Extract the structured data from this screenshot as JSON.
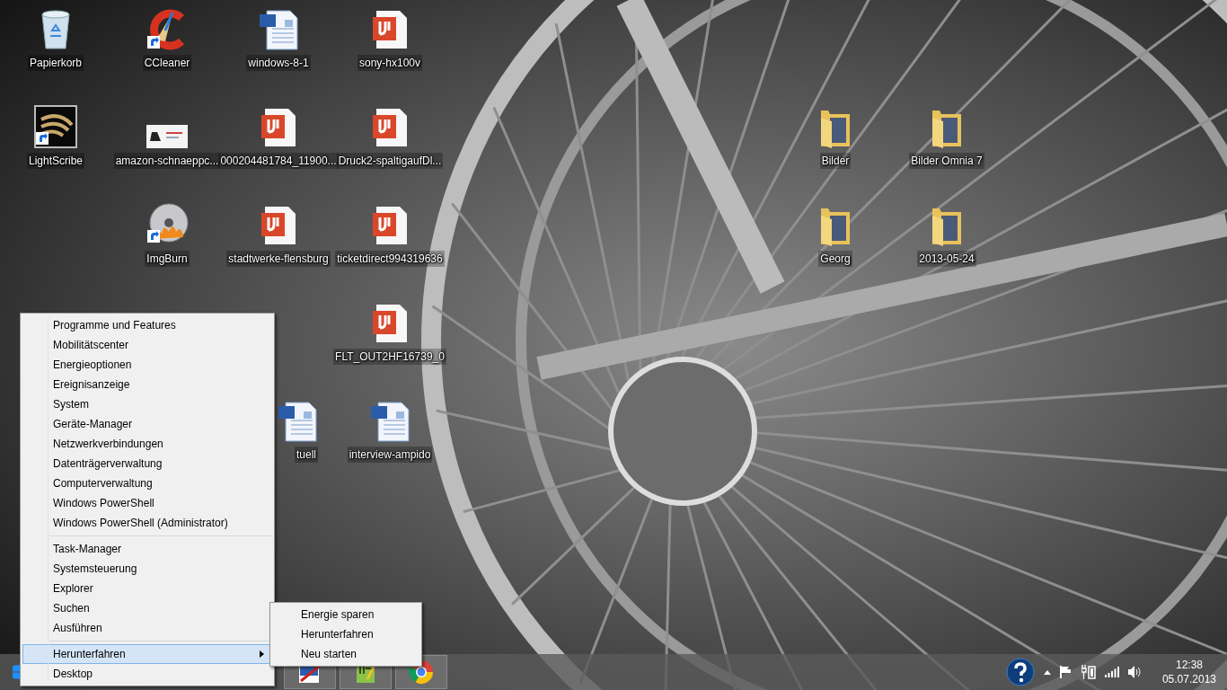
{
  "desktop_icons": [
    {
      "label": "Papierkorb",
      "kind": "recycle_bin"
    },
    {
      "label": "CCleaner",
      "kind": "cleaner_shortcut"
    },
    {
      "label": "windows-8-1",
      "kind": "word_document"
    },
    {
      "label": "sony-hx100v",
      "kind": "pdf_document"
    },
    {
      "label": "LightScribe",
      "kind": "lightscribe_shortcut"
    },
    {
      "label": "amazon-schnaeppc...",
      "kind": "image_file"
    },
    {
      "label": "000204481784_11900...",
      "kind": "pdf_document"
    },
    {
      "label": "Druck2-spaltigaufDl...",
      "kind": "pdf_document"
    },
    {
      "label": "Bilder",
      "kind": "folder"
    },
    {
      "label": "Bilder Omnia 7",
      "kind": "folder"
    },
    {
      "label": "ImgBurn",
      "kind": "disc_shortcut"
    },
    {
      "label": "stadtwerke-flensburg",
      "kind": "pdf_document"
    },
    {
      "label": "ticketdirect994319636",
      "kind": "pdf_document"
    },
    {
      "label": "Georg",
      "kind": "folder"
    },
    {
      "label": "2013-05-24",
      "kind": "folder"
    },
    {
      "label": "FLT_OUT2HF16739_0",
      "kind": "pdf_document"
    },
    {
      "label": "tuell",
      "kind": "word_document"
    },
    {
      "label": "interview-ampido",
      "kind": "word_document"
    }
  ],
  "context_menu": {
    "groups": [
      [
        {
          "label": "Programme und Features",
          "selected": false,
          "submenu": false
        },
        {
          "label": "Mobilitätscenter",
          "selected": false,
          "submenu": false
        },
        {
          "label": "Energieoptionen",
          "selected": false,
          "submenu": false
        },
        {
          "label": "Ereignisanzeige",
          "selected": false,
          "submenu": false
        },
        {
          "label": "System",
          "selected": false,
          "submenu": false
        },
        {
          "label": "Geräte-Manager",
          "selected": false,
          "submenu": false
        },
        {
          "label": "Netzwerkverbindungen",
          "selected": false,
          "submenu": false
        },
        {
          "label": "Datenträgerverwaltung",
          "selected": false,
          "submenu": false
        },
        {
          "label": "Computerverwaltung",
          "selected": false,
          "submenu": false
        },
        {
          "label": "Windows PowerShell",
          "selected": false,
          "submenu": false
        },
        {
          "label": "Windows PowerShell (Administrator)",
          "selected": false,
          "submenu": false
        }
      ],
      [
        {
          "label": "Task-Manager",
          "selected": false,
          "submenu": false
        },
        {
          "label": "Systemsteuerung",
          "selected": false,
          "submenu": false
        },
        {
          "label": "Explorer",
          "selected": false,
          "submenu": false
        },
        {
          "label": "Suchen",
          "selected": false,
          "submenu": false
        },
        {
          "label": "Ausführen",
          "selected": false,
          "submenu": false
        }
      ],
      [
        {
          "label": "Herunterfahren",
          "selected": true,
          "submenu": true
        },
        {
          "label": "Desktop",
          "selected": false,
          "submenu": false
        }
      ]
    ]
  },
  "submenu": {
    "items": [
      {
        "label": "Energie sparen",
        "selected": false
      },
      {
        "label": "Herunterfahren",
        "selected": false
      },
      {
        "label": "Neu starten",
        "selected": false
      }
    ]
  },
  "taskbar": {
    "apps": [
      {
        "kind": "paint"
      },
      {
        "kind": "notepad"
      },
      {
        "kind": "browser"
      }
    ],
    "tray": {
      "time": "12:38",
      "date": "05.07.2013"
    }
  }
}
